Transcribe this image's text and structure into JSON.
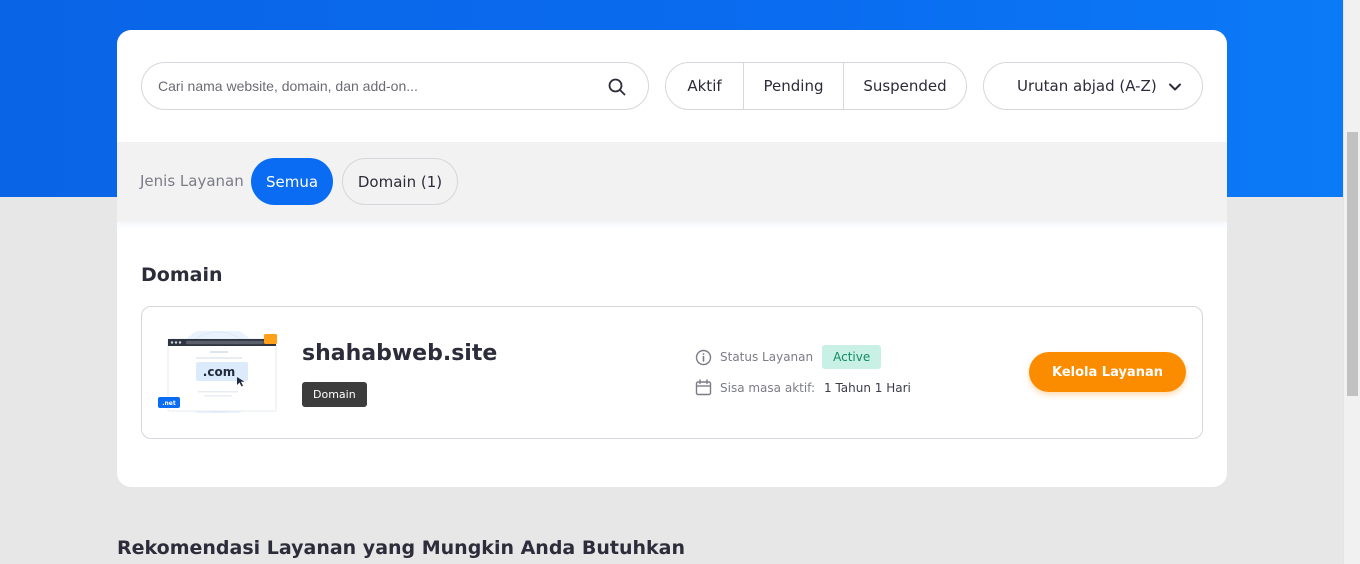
{
  "search": {
    "placeholder": "Cari nama website, domain, dan add-on...",
    "icon": "search-icon"
  },
  "status_filters": [
    {
      "label": "Aktif"
    },
    {
      "label": "Pending"
    },
    {
      "label": "Suspended"
    }
  ],
  "sort": {
    "selected": "Urutan abjad (A-Z)",
    "icon": "chevron-down-icon"
  },
  "service_type_filter": {
    "label": "Jenis Layanan",
    "options": [
      {
        "label": "Semua",
        "active": true
      },
      {
        "label": "Domain (1)",
        "active": false
      }
    ]
  },
  "section": {
    "title": "Domain"
  },
  "service": {
    "name": "shahabweb.site",
    "type_badge": "Domain",
    "thumb_text": ".com",
    "thumb_tag": ".net",
    "status_label": "Status Layanan",
    "status_value": "Active",
    "remaining_label": "Sisa masa aktif:",
    "remaining_value": "1 Tahun 1 Hari",
    "manage_label": "Kelola Layanan"
  },
  "recommendation": {
    "title": "Rekomendasi Layanan yang Mungkin Anda Butuhkan"
  },
  "colors": {
    "primary": "#0a6cf3",
    "accent": "#fb8c00",
    "active_badge_bg": "#c8f0e4",
    "active_badge_text": "#138a63"
  }
}
